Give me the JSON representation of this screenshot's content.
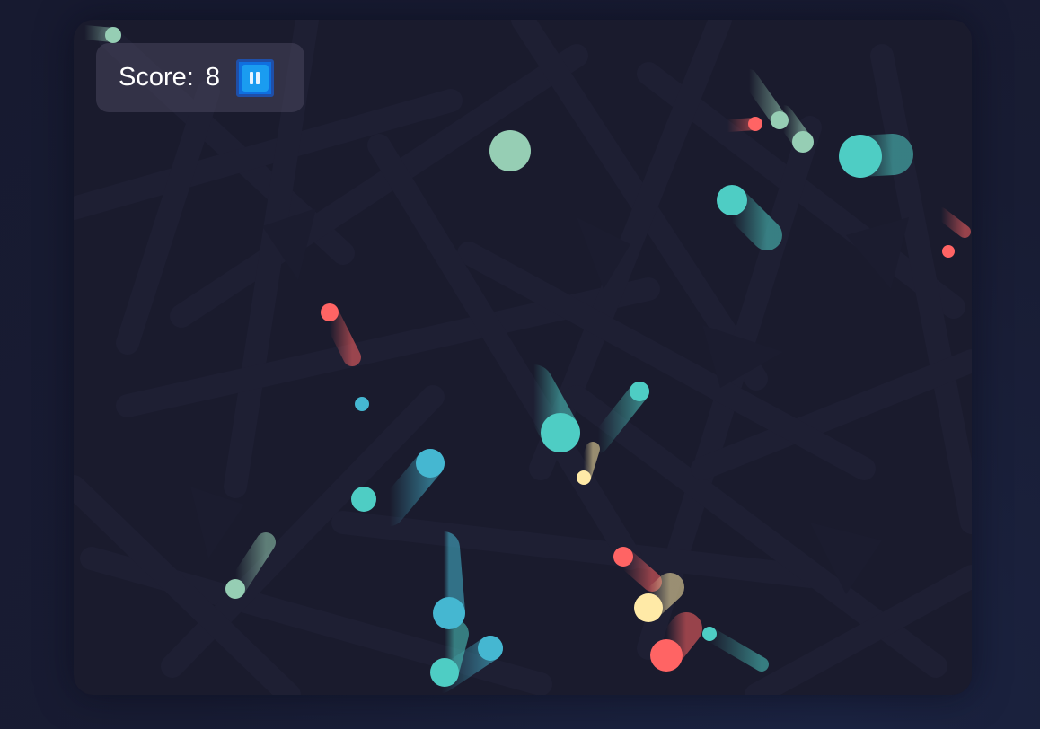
{
  "hud": {
    "score_label": "Score:",
    "score_value": "8",
    "pause_icon": "pause-icon"
  },
  "colors": {
    "page_background": "#181c33",
    "arena_background": "#1a1b2d",
    "red": "#ff6464",
    "teal": "#4ecdc4",
    "sky": "#45b7d1",
    "mint": "#96ceb4",
    "cream": "#ffeaa7"
  }
}
